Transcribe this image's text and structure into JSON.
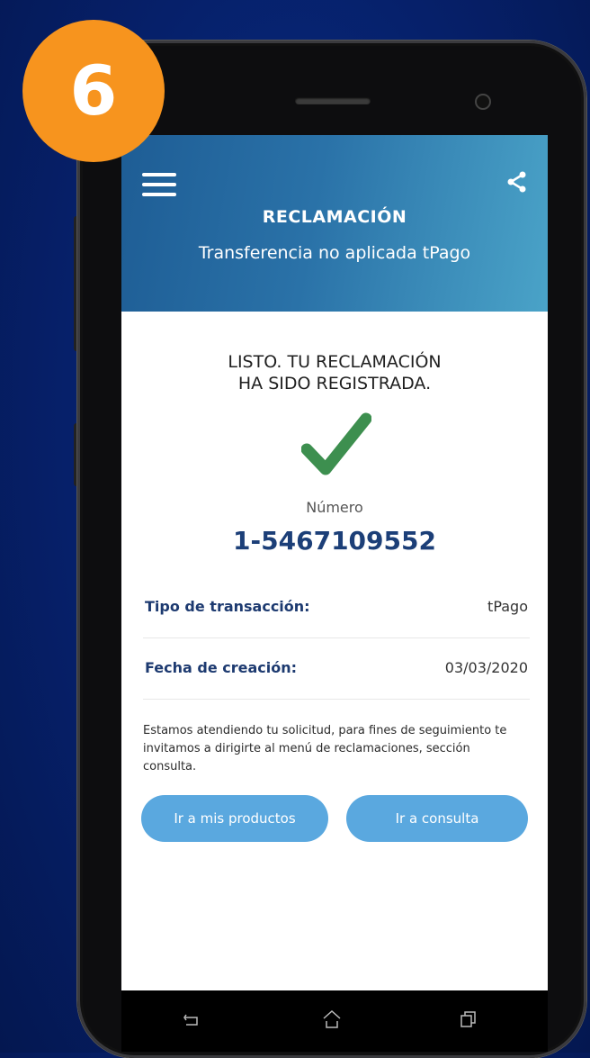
{
  "step_badge": "6",
  "header": {
    "title": "RECLAMACIÓN",
    "subtitle": "Transferencia no aplicada tPago"
  },
  "success": {
    "title": "LISTO. TU RECLAMACIÓN\nHA SIDO REGISTRADA.",
    "numero_label": "Número",
    "numero_value": "1-5467109552"
  },
  "details": [
    {
      "label": "Tipo de transacción:",
      "value": "tPago"
    },
    {
      "label": "Fecha de creación:",
      "value": "03/03/2020"
    }
  ],
  "note": "Estamos atendiendo tu solicitud, para fines de seguimiento te invitamos a dirigirte al menú de reclamaciones, sección consulta.",
  "buttons": {
    "productos": "Ir a mis productos",
    "consulta": "Ir a consulta"
  },
  "colors": {
    "accent": "#5aa8df",
    "header_start": "#1e5d95",
    "header_end": "#4aa3c8",
    "check": "#3d8f4f",
    "badge": "#f7941e",
    "number": "#1c3f78"
  },
  "icons": [
    "menu-icon",
    "share-icon",
    "check-icon",
    "back-icon",
    "home-icon",
    "recent-apps-icon"
  ]
}
